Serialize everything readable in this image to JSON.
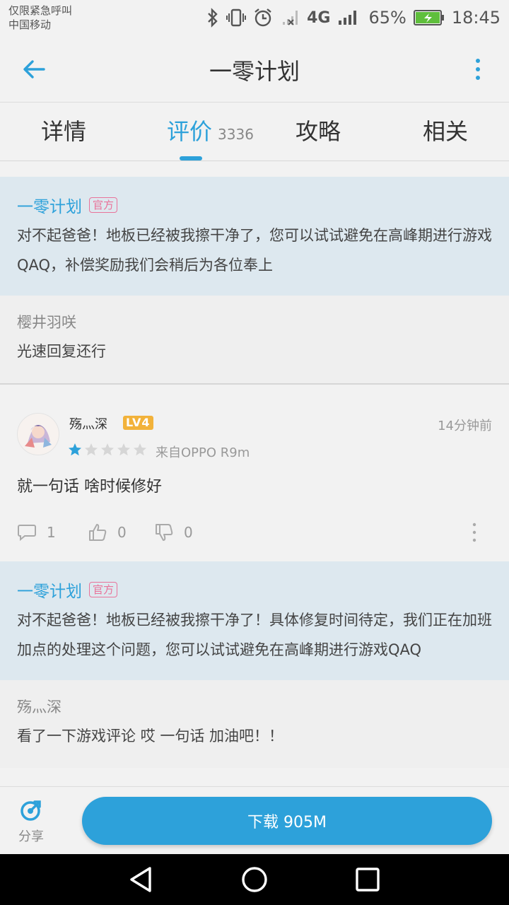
{
  "status_bar": {
    "carrier_line1": "仅限紧急呼叫",
    "carrier_line2": "中国移动",
    "network": "4G",
    "battery_percent": "65%",
    "time": "18:45"
  },
  "header": {
    "title": "一零计划"
  },
  "tabs": [
    {
      "label": "详情"
    },
    {
      "label": "评价",
      "count": "3336"
    },
    {
      "label": "攻略"
    },
    {
      "label": "相关"
    }
  ],
  "thread1": {
    "official": {
      "name": "一零计划",
      "badge": "官方",
      "text": "对不起爸爸！地板已经被我擦干净了，您可以试试避免在高峰期进行游戏QAQ，补偿奖励我们会稍后为各位奉上"
    },
    "reply": {
      "name": "樱井羽咲",
      "text": "光速回复还行"
    }
  },
  "review": {
    "username": "殇灬深",
    "level": "LV4",
    "time": "14分钟前",
    "rating": 1,
    "rating_max": 5,
    "device": "来自OPPO R9m",
    "text": "就一句话 啥时候修好",
    "comments": "1",
    "likes": "0",
    "dislikes": "0"
  },
  "thread2": {
    "official": {
      "name": "一零计划",
      "badge": "官方",
      "text": "对不起爸爸！地板已经被我擦干净了！具体修复时间待定，我们正在加班加点的处理这个问题，您可以试试避免在高峰期进行游戏QAQ"
    },
    "reply": {
      "name": "殇灬深",
      "text": "看了一下游戏评论 哎 一句话 加油吧！！"
    }
  },
  "bottom": {
    "share_label": "分享",
    "download_label": "下载 905M"
  },
  "colors": {
    "accent": "#2da1da",
    "official_bg": "#dde8ef",
    "badge": "#e9739a",
    "level": "#f2b23a"
  },
  "icons": [
    "back-arrow-icon",
    "more-vert-icon",
    "bluetooth-icon",
    "vibrate-icon",
    "alarm-icon",
    "signal-icon",
    "battery-icon",
    "comment-icon",
    "thumb-up-icon",
    "thumb-down-icon",
    "share-icon",
    "nav-back-icon",
    "nav-home-icon",
    "nav-recent-icon"
  ]
}
